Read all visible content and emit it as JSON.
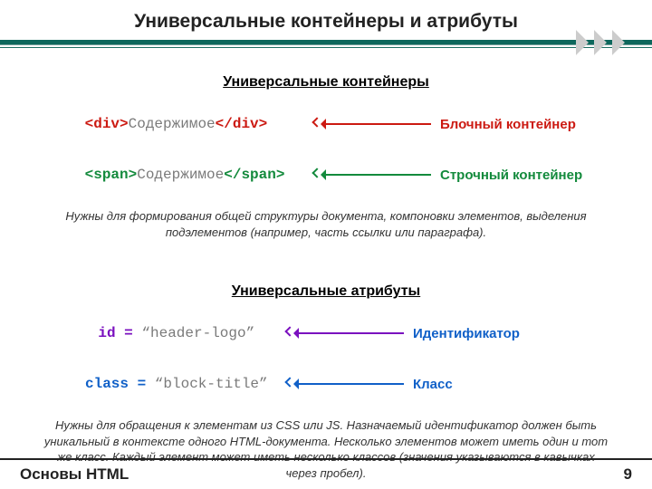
{
  "title": "Универсальные контейнеры и атрибуты",
  "section1": {
    "heading": "Универсальные контейнеры",
    "row1": {
      "open": "<div>",
      "content": "Содержимое",
      "close": "</div>",
      "label": "Блочный контейнер"
    },
    "row2": {
      "open": "<span>",
      "content": "Содержимое",
      "close": "</span>",
      "label": "Строчный контейнер"
    },
    "note": "Нужны для формирования общей структуры документа, компоновки элементов, выделения подэлементов (например, часть ссылки или параграфа)."
  },
  "section2": {
    "heading": "Универсальные атрибуты",
    "row1": {
      "attr": "id = ",
      "val": "“header-logo”",
      "label": "Идентификатор"
    },
    "row2": {
      "attr": "class = ",
      "val": "“block-title”",
      "label": "Класс"
    },
    "note": "Нужны для обращения к элементам из CSS или JS. Назначаемый идентификатор должен быть уникальный в контексте одного HTML-документа. Несколько элементов может иметь один и тот же класс. Каждый элемент может иметь несколько классов (значения указываются в кавычках через пробел)."
  },
  "footer": {
    "text": "Основы HTML",
    "page": "9"
  }
}
